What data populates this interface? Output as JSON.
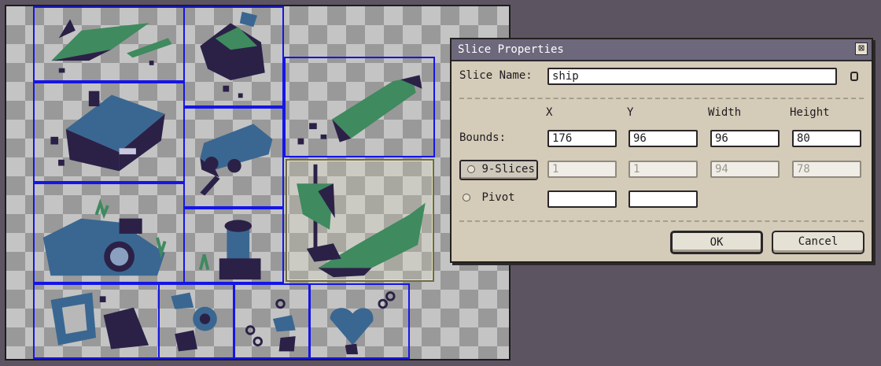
{
  "dialog": {
    "title": "Slice Properties",
    "close_label": "⊠",
    "slice_name_label": "Slice Name:",
    "slice_name_value": "ship",
    "headers": {
      "x": "X",
      "y": "Y",
      "width": "Width",
      "height": "Height"
    },
    "bounds_label": "Bounds:",
    "bounds": {
      "x": "176",
      "y": "96",
      "width": "96",
      "height": "80"
    },
    "nine_slices_label": "9-Slices",
    "nine_slices": {
      "x": "1",
      "y": "1",
      "width": "94",
      "height": "78"
    },
    "pivot_label": "Pivot",
    "pivot": {
      "x": "",
      "y": ""
    },
    "ok_label": "OK",
    "cancel_label": "Cancel"
  },
  "colors": {
    "slice_border": "#1515e6",
    "selected_border": "#6d6a4d",
    "sprite_dark": "#2b2147",
    "sprite_green": "#3f8a5e",
    "sprite_blue": "#3a6791"
  },
  "sprites": [
    "crystals",
    "rock",
    "spire",
    "house",
    "car",
    "squid",
    "ship",
    "pipes",
    "hydrant",
    "debris",
    "valve-parts",
    "chain",
    "heart"
  ]
}
